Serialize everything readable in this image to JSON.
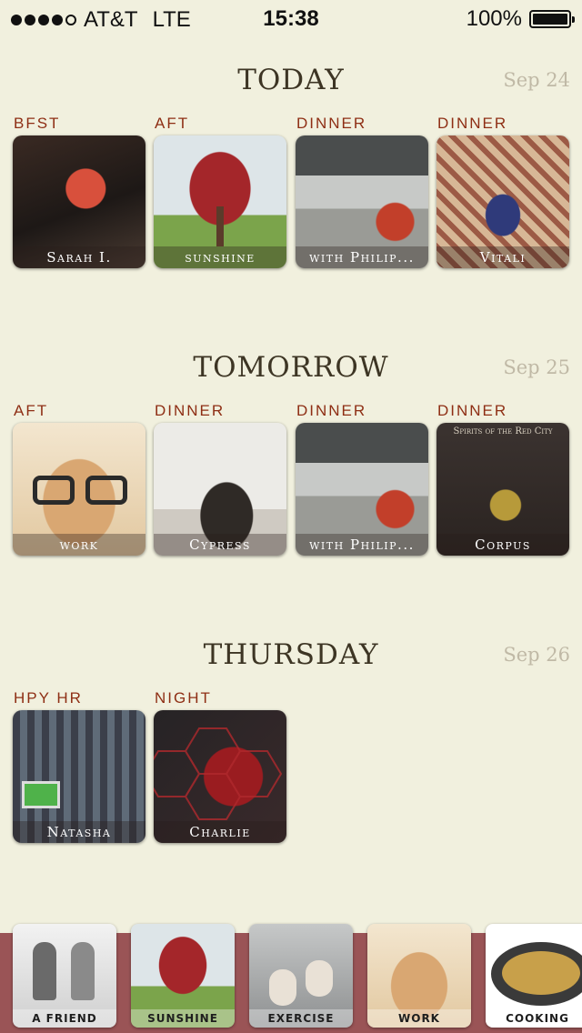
{
  "status": {
    "carrier": "AT&T",
    "network": "LTE",
    "time": "15:38",
    "battery": "100%",
    "signal_bars": 4,
    "signal_total": 5
  },
  "days": [
    {
      "title": "TODAY",
      "date": "Sep 24",
      "items": [
        {
          "slot": "BFST",
          "caption": "Sarah I.",
          "icon": "sarah-photo"
        },
        {
          "slot": "AFT",
          "caption": "sunshine",
          "icon": "tree-photo"
        },
        {
          "slot": "DINNER",
          "caption": "with Philip...",
          "icon": "street-photo"
        },
        {
          "slot": "DINNER",
          "caption": "Vitali",
          "icon": "dancers-photo"
        }
      ]
    },
    {
      "title": "TOMORROW",
      "date": "Sep 25",
      "items": [
        {
          "slot": "AFT",
          "caption": "work",
          "icon": "dog-photo"
        },
        {
          "slot": "DINNER",
          "caption": "Cypress",
          "icon": "resting-photo"
        },
        {
          "slot": "DINNER",
          "caption": "with Philip...",
          "icon": "street-photo"
        },
        {
          "slot": "DINNER",
          "caption": "Corpus",
          "icon": "album-photo"
        }
      ]
    },
    {
      "title": "THURSDAY",
      "date": "Sep 26",
      "items": [
        {
          "slot": "HPY HR",
          "caption": "Natasha",
          "icon": "club-photo"
        },
        {
          "slot": "NIGHT",
          "caption": "Charlie",
          "icon": "hexagon-photo"
        }
      ]
    }
  ],
  "album_text": "Spirits of the Red City",
  "tabs": [
    {
      "label": "A FRIEND",
      "icon": "friends-photo"
    },
    {
      "label": "SUNSHINE",
      "icon": "tree-photo"
    },
    {
      "label": "EXERCISE",
      "icon": "shoes-photo"
    },
    {
      "label": "WORK",
      "icon": "dog-photo"
    },
    {
      "label": "COOKING",
      "icon": "pan-photo"
    }
  ]
}
